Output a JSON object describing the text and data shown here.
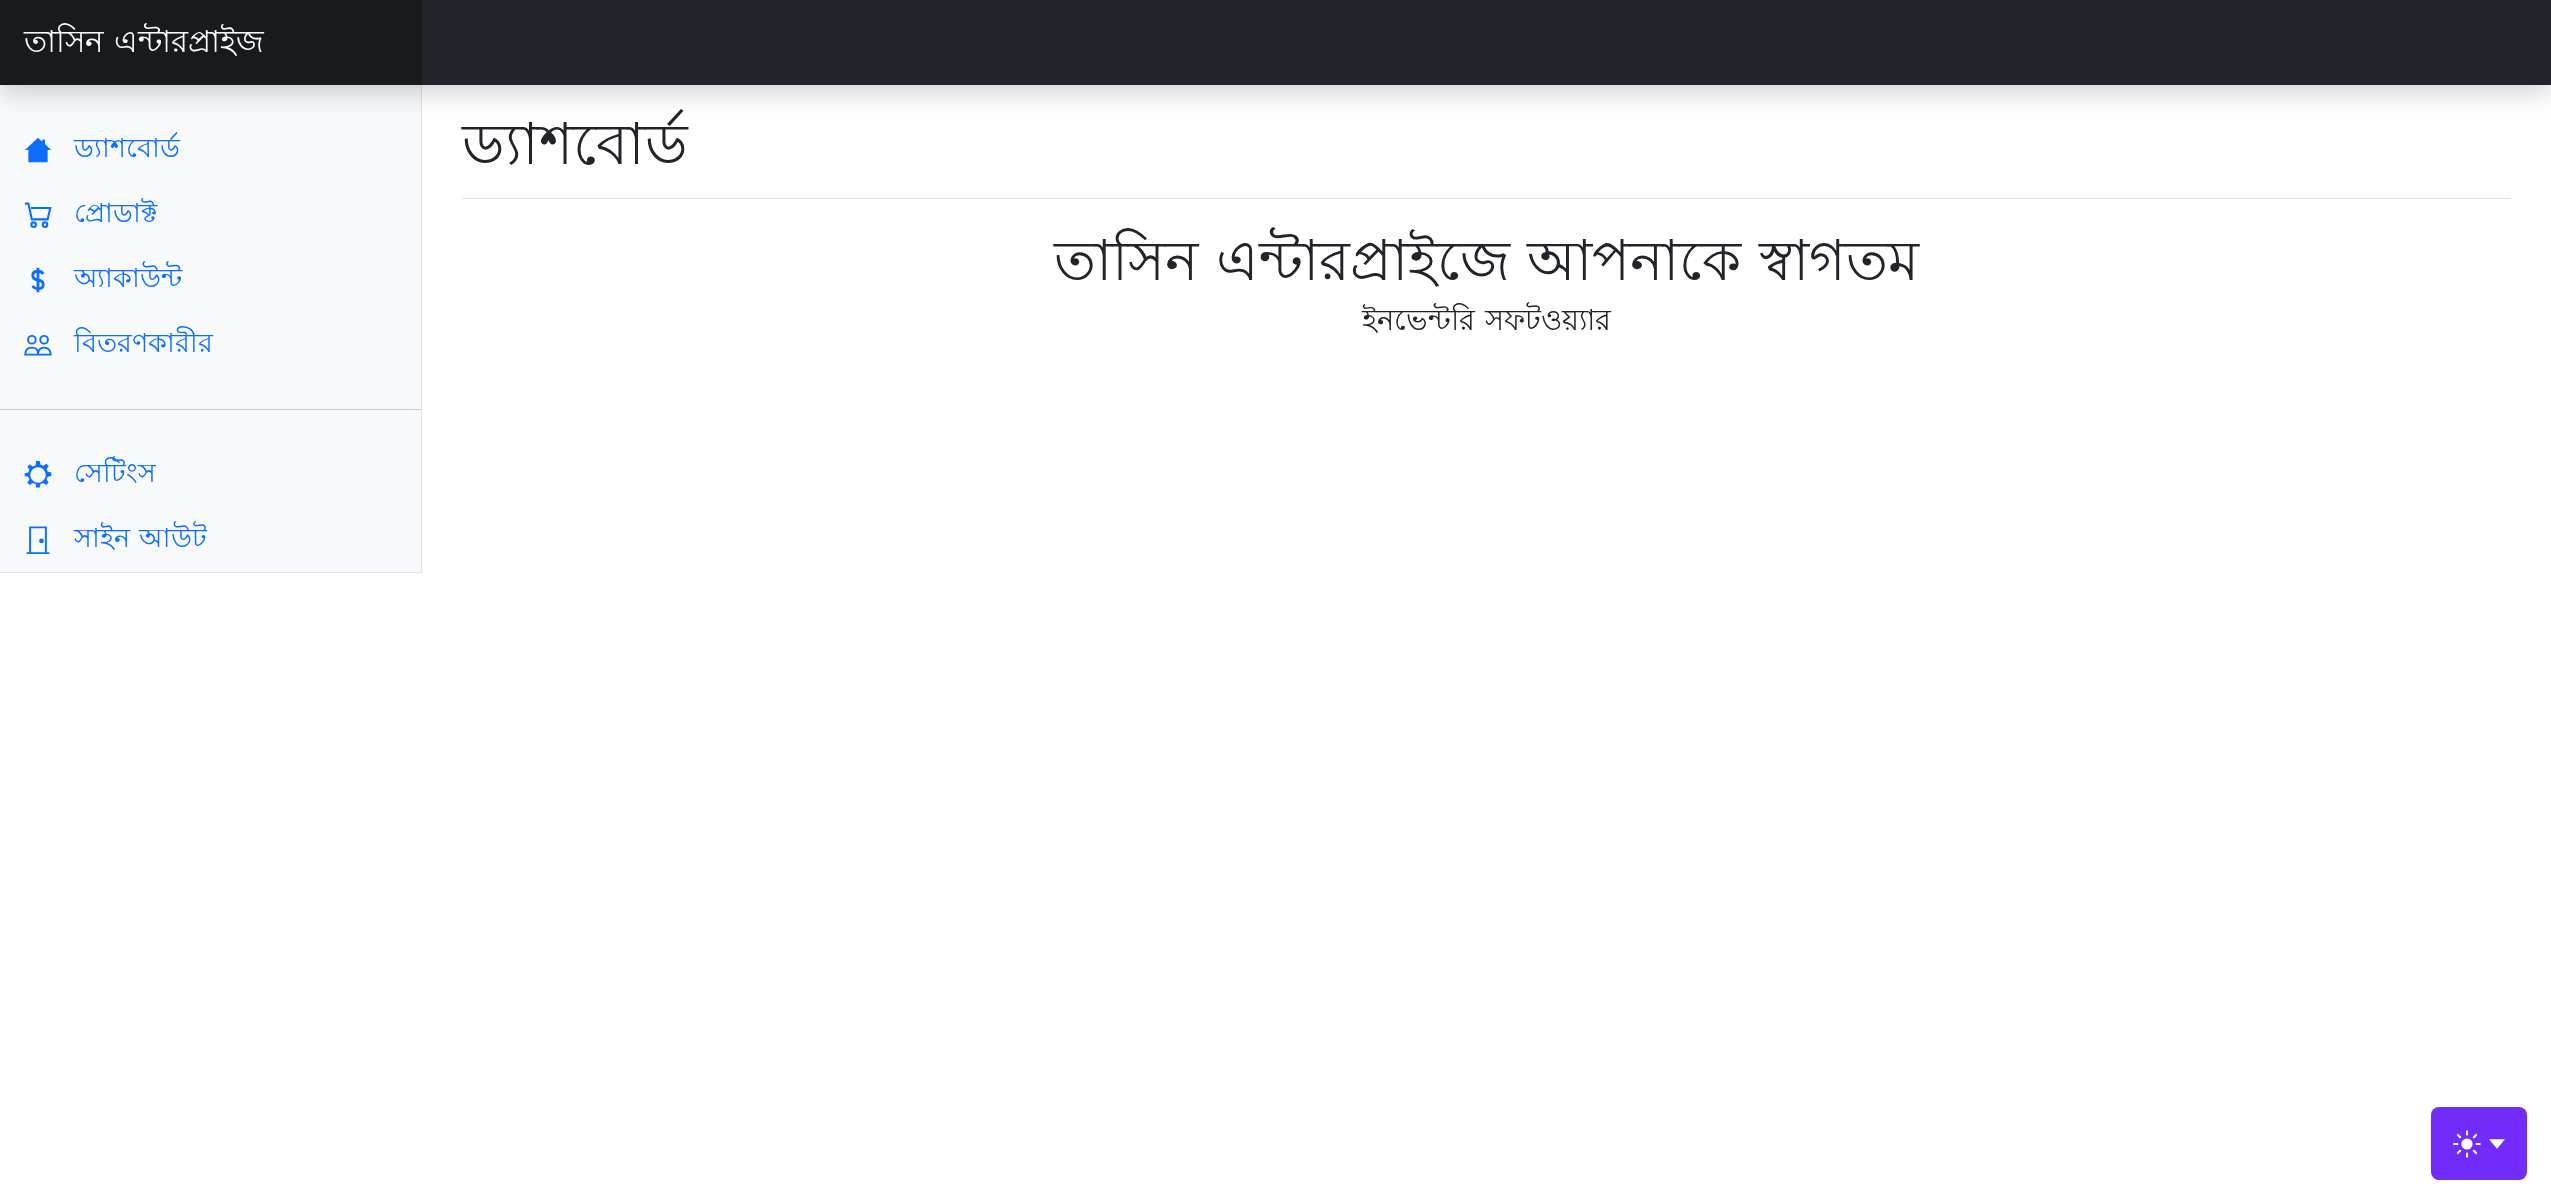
{
  "navbar": {
    "brand": "তাসিন এন্টারপ্রাইজ"
  },
  "sidebar": {
    "items": [
      {
        "label": "ড্যাশবোর্ড"
      },
      {
        "label": "প্রোডাক্ট"
      },
      {
        "label": "অ্যাকাউন্ট"
      },
      {
        "label": "বিতরণকারীর"
      }
    ],
    "footer_items": [
      {
        "label": "সেটিংস"
      },
      {
        "label": "সাইন আউট"
      }
    ]
  },
  "main": {
    "title": "ড্যাশবোর্ড",
    "welcome": "তাসিন এন্টারপ্রাইজে আপনাকে স্বাগতম",
    "subtitle": "ইনভেন্টরি সফটওয়্যার"
  }
}
